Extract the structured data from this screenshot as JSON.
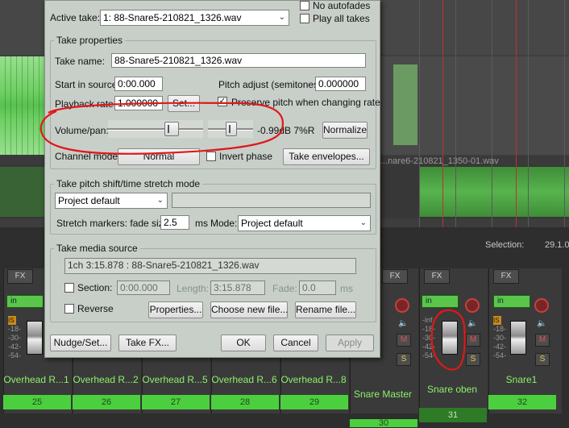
{
  "colors": {
    "accent_green": "#4ccf3e",
    "annotation_red": "#e01818",
    "dialog_bg": "#c8cfc9"
  },
  "arrange": {
    "item_title": "...nare6-210821_1350-01.wav",
    "selection_label": "Selection:",
    "selection_value": "29.1.0"
  },
  "dialog": {
    "active_take_label": "Active take:",
    "active_take_value": "1: 88-Snare5-210821_1326.wav",
    "no_autofades_label": "No autofades",
    "play_all_takes_label": "Play all takes",
    "take_properties": {
      "title": "Take properties",
      "take_name_label": "Take name:",
      "take_name_value": "88-Snare5-210821_1326.wav",
      "start_in_source_label": "Start in source:",
      "start_in_source_value": "0:00.000",
      "pitch_adjust_label": "Pitch adjust (semitones):",
      "pitch_adjust_value": "0.000000",
      "playback_rate_label": "Playback rate:",
      "playback_rate_value": "1.000000",
      "set_button": "Set...",
      "preserve_pitch_label": "Preserve pitch when changing rate",
      "preserve_pitch_checked": true,
      "volume_pan_label": "Volume/pan:",
      "volume_pan_readout": "-0.99dB 7%R",
      "normalize_button": "Normalize",
      "channel_mode_label": "Channel mode:",
      "channel_mode_value": "Normal",
      "invert_phase_label": "Invert phase",
      "invert_phase_checked": false,
      "take_envelopes_button": "Take envelopes..."
    },
    "pitch_shift": {
      "title": "Take pitch shift/time stretch mode",
      "mode_value": "Project default",
      "stretch_markers_label": "Stretch markers: fade size:",
      "fade_size_value": "2.5",
      "ms_label": "ms",
      "mode_label": "Mode:",
      "mode2_value": "Project default"
    },
    "media_source": {
      "title": "Take media source",
      "source_value": "1ch 3:15.878 : 88-Snare5-210821_1326.wav",
      "section_label": "Section:",
      "section_value": "0:00.000",
      "length_label": "Length:",
      "length_value": "3:15.878",
      "fade_label": "Fade:",
      "fade_value": "0.0",
      "fade_ms_label": "ms",
      "reverse_label": "Reverse",
      "properties_button": "Properties...",
      "choose_new_file_button": "Choose new file...",
      "rename_file_button": "Rename file..."
    },
    "footer": {
      "nudge_button": "Nudge/Set...",
      "take_fx_button": "Take FX...",
      "ok_button": "OK",
      "cancel_button": "Cancel",
      "apply_button": "Apply"
    }
  },
  "mixer": {
    "fx_label": "FX",
    "in_label": "in",
    "m_label": "M",
    "s_label": "S",
    "io_label": "IS",
    "neg_inf": "-inf",
    "ticks": [
      "-18-",
      "-30-",
      "-42-",
      "-54-"
    ],
    "strips": [
      {
        "name": "Overhead R...1",
        "number": "25"
      },
      {
        "name": "Overhead R...2",
        "number": "26"
      },
      {
        "name": "Overhead R...5",
        "number": "27"
      },
      {
        "name": "Overhead R...6",
        "number": "28"
      },
      {
        "name": "Overhead R...8",
        "number": "29"
      },
      {
        "name": "Snare Master",
        "number": "30"
      },
      {
        "name": "Snare oben",
        "number": "31"
      },
      {
        "name": "Snare1",
        "number": "32"
      }
    ]
  }
}
